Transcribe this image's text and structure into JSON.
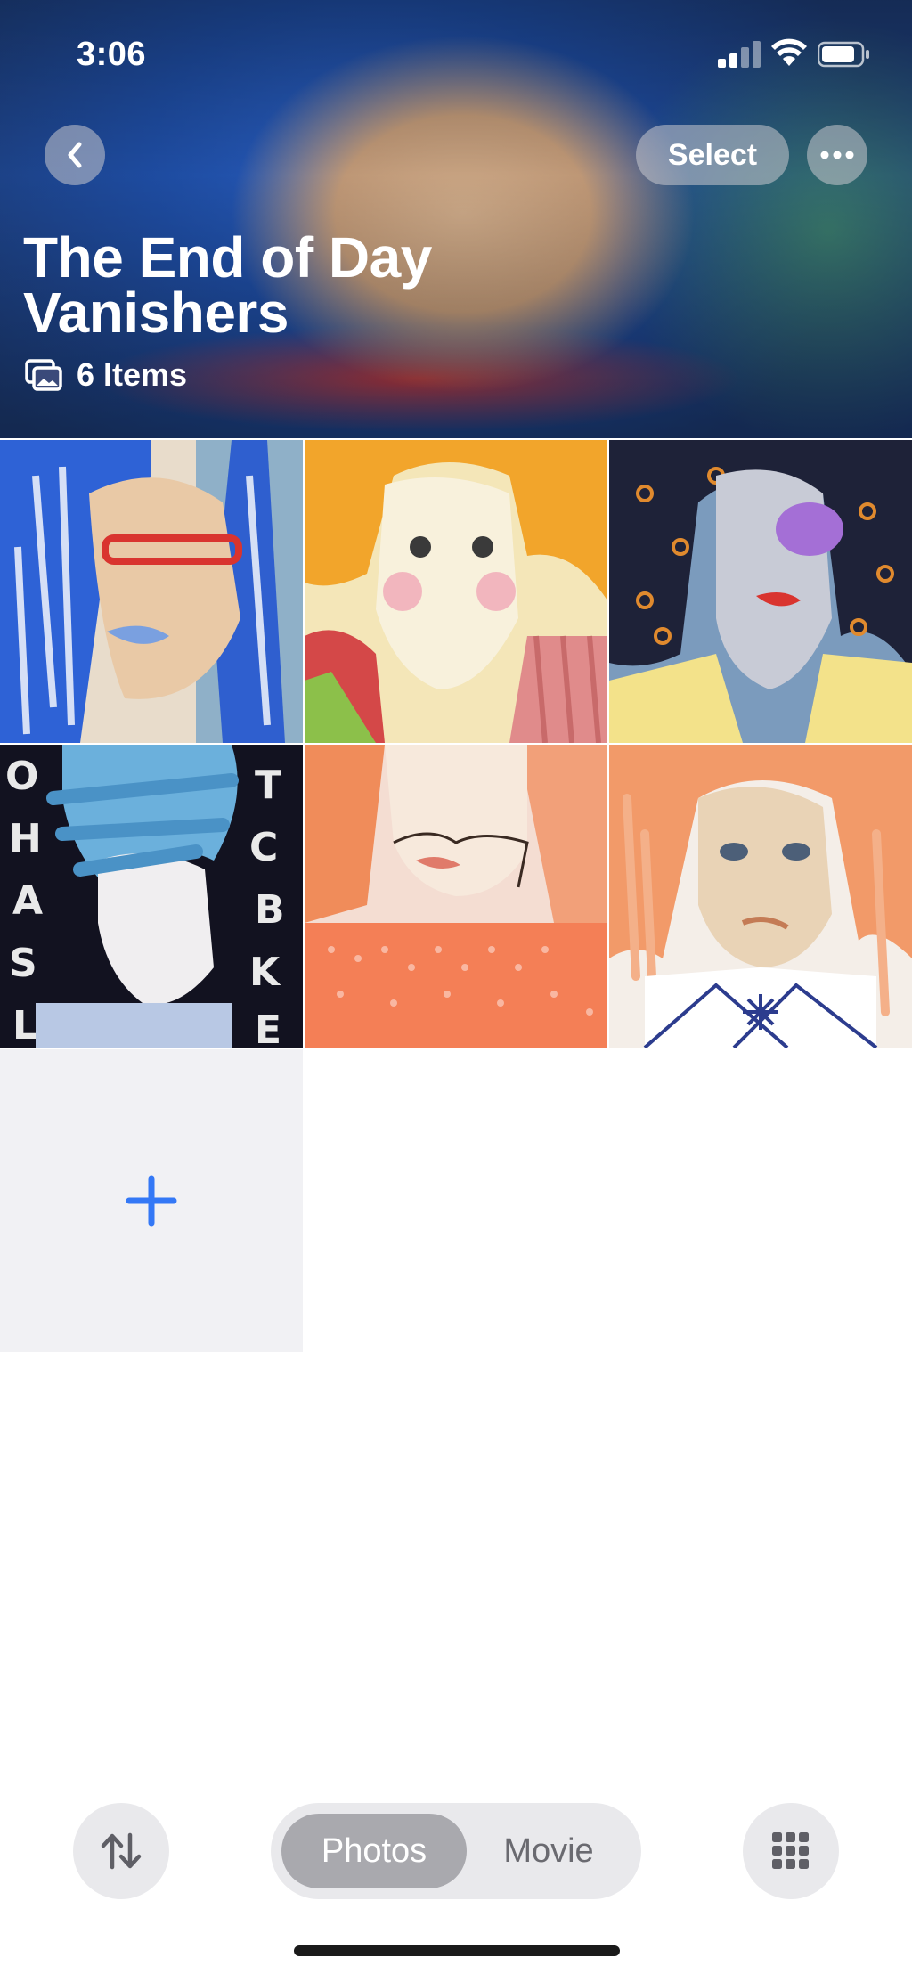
{
  "status_bar": {
    "time": "3:06"
  },
  "nav": {
    "select_label": "Select"
  },
  "album": {
    "title": "The End of Day Vanishers",
    "item_count": "6 Items"
  },
  "grid": {
    "photos": [
      {
        "name": "photo-blue-hair-red-glasses"
      },
      {
        "name": "photo-yellow-hair-hand-on-cheek"
      },
      {
        "name": "photo-dark-hair-purple-sunglasses"
      },
      {
        "name": "photo-blue-hair-letters-background"
      },
      {
        "name": "photo-orange-hair-pink-top"
      },
      {
        "name": "photo-orange-hair-white-collar"
      }
    ]
  },
  "toolbar": {
    "segments": [
      {
        "label": "Photos",
        "active": true
      },
      {
        "label": "Movie",
        "active": false
      }
    ]
  },
  "colors": {
    "accent": "#3478f6",
    "segment_active_bg": "#a9a9ae",
    "tool_bg": "#e9e9ec",
    "add_tile_bg": "#f1f1f4"
  },
  "icons": {
    "back": "chevron-left-icon",
    "more": "ellipsis-icon",
    "items": "photo-stack-icon",
    "add": "plus-icon",
    "sort": "sort-arrows-icon",
    "grid": "grid-icon"
  }
}
